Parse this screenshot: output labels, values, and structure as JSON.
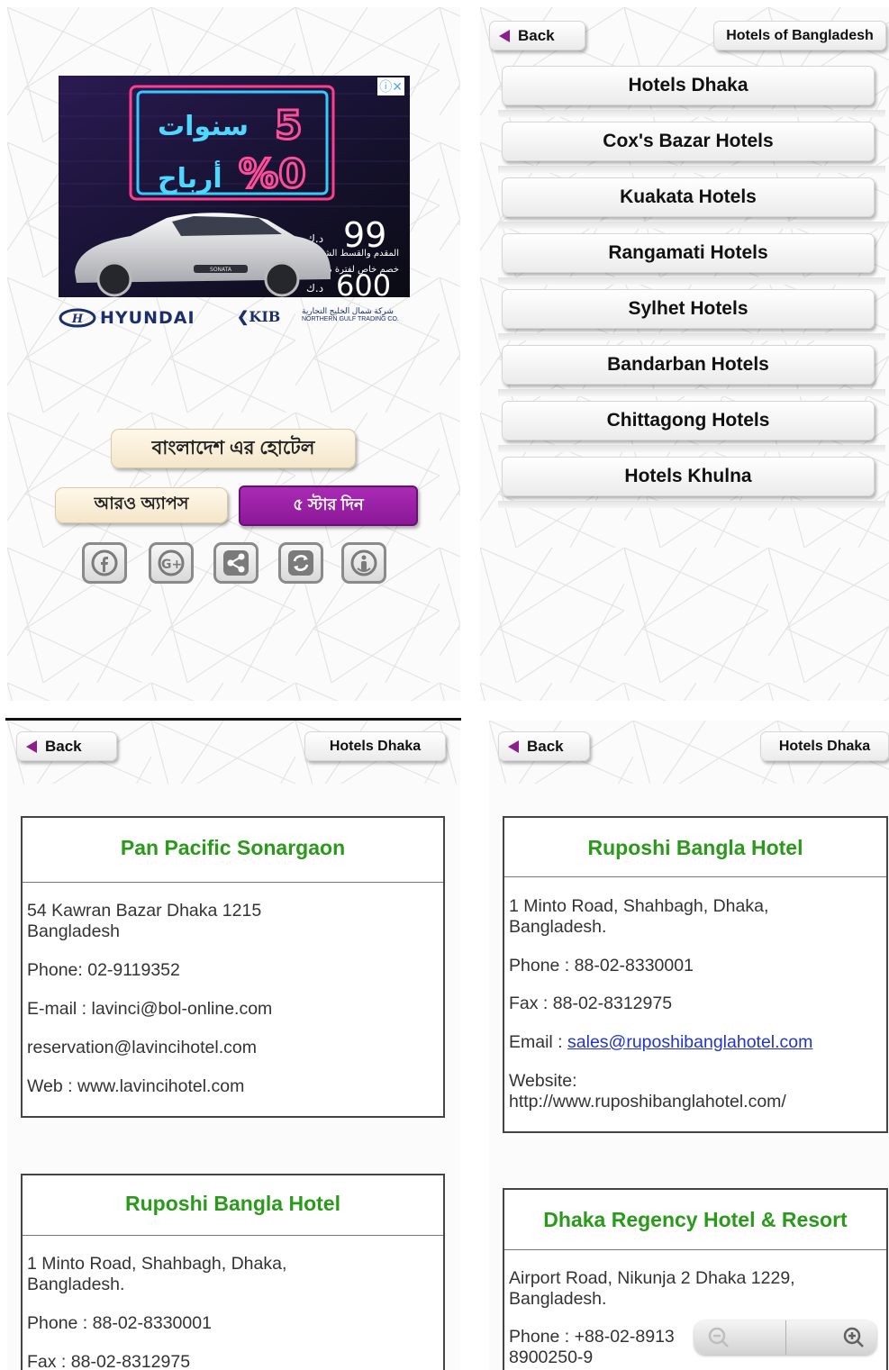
{
  "panel1": {
    "ad": {
      "arabic_line1": "سنوات",
      "digit_5": "5",
      "arabic_line2": "أرباح",
      "percent_0": "%0",
      "price_99": "99",
      "currency": "د.ك",
      "arabic_small1": "المقدم والقسط الشهري",
      "arabic_small2": "خصم خاص لفترة محدودة",
      "price_600": "600",
      "car_badge": "SONATA",
      "brand": "HYUNDAI",
      "dealer": "KIB",
      "partner_ar": "شركة شمال الخليج التجارية",
      "partner_en": "NORTHERN GULF TRADING CO.",
      "adchoices": "ⓘ✕"
    },
    "main_button": "বাংলাদেশ এর হোটেল",
    "more_apps_button": "আরও অ্যাপস",
    "rate_button": "৫ স্টার দিন",
    "social_icons": [
      "facebook-icon",
      "google-plus-icon",
      "share-icon",
      "refresh-icon",
      "info-icon"
    ],
    "accent_color": "#9d1fa8"
  },
  "panel2": {
    "back_label": "Back",
    "header_title": "Hotels of Bangladesh",
    "menu_items": [
      "Hotels Dhaka",
      "Cox's Bazar Hotels",
      "Kuakata Hotels",
      "Rangamati Hotels",
      "Sylhet Hotels",
      "Bandarban Hotels",
      "Chittagong Hotels",
      "Hotels Khulna"
    ]
  },
  "panel3": {
    "back_label": "Back",
    "header_title": "Hotels Dhaka",
    "cards": [
      {
        "name": "Pan Pacific Sonargaon",
        "address": "54 Kawran Bazar Dhaka 1215 Bangladesh",
        "phone": "Phone: 02-9119352",
        "email": "E-mail : lavinci@bol-online.com",
        "email2": "reservation@lavincihotel.com",
        "web": "Web : www.lavincihotel.com"
      },
      {
        "name": "Ruposhi Bangla Hotel",
        "address": "1 Minto Road, Shahbagh, Dhaka, Bangladesh.",
        "phone": "Phone : 88-02-8330001",
        "fax": "Fax : 88-02-8312975"
      }
    ]
  },
  "panel4": {
    "back_label": "Back",
    "header_title": "Hotels Dhaka",
    "cards": [
      {
        "name": "Ruposhi Bangla Hotel",
        "address": "1 Minto Road, Shahbagh, Dhaka, Bangladesh.",
        "phone": "Phone : 88-02-8330001",
        "fax": "Fax : 88-02-8312975",
        "email_label": "Email : ",
        "email_link": "sales@ruposhibanglahotel.com",
        "website_label": "Website:",
        "website_url": "http://www.ruposhibanglahotel.com/"
      },
      {
        "name": "Dhaka Regency Hotel & Resort",
        "address": "Airport Road, Nikunja 2 Dhaka 1229, Bangladesh.",
        "phone": "Phone : +88-02-8913",
        "phone2": "8900250-9"
      }
    ],
    "zoom_out_icon": "zoom-out-icon",
    "zoom_in_icon": "zoom-in-icon"
  },
  "colors": {
    "hotel_name_green": "#2a9a1a",
    "back_triangle": "#8b1f8b",
    "link_blue": "#2233cc"
  }
}
